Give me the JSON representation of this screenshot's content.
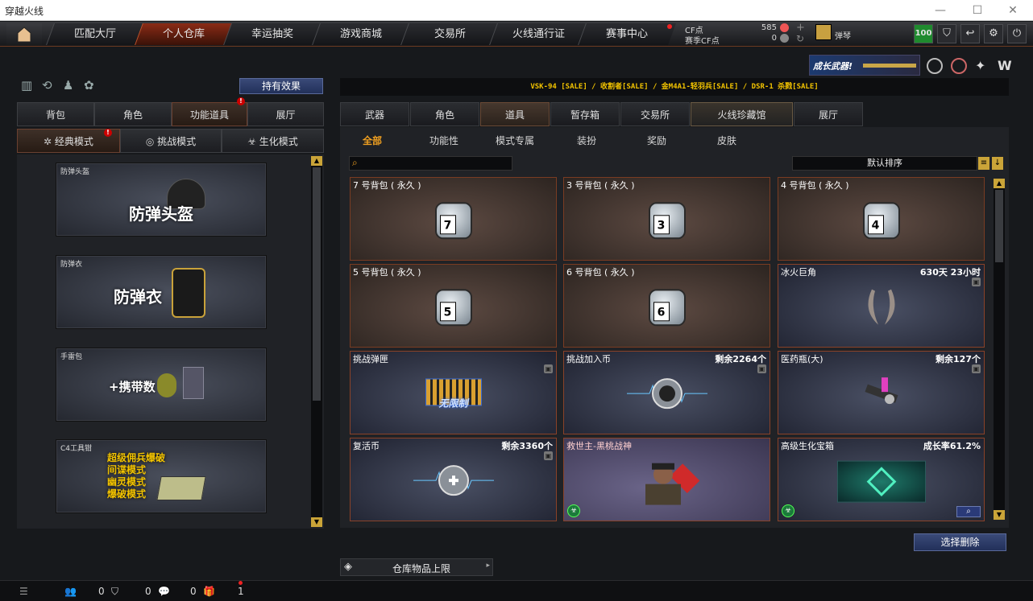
{
  "window": {
    "title": "穿越火线"
  },
  "nav": {
    "tabs": [
      {
        "label": "匹配大厅"
      },
      {
        "label": "个人仓库"
      },
      {
        "label": "幸运抽奖"
      },
      {
        "label": "游戏商城"
      },
      {
        "label": "交易所"
      },
      {
        "label": "火线通行证"
      },
      {
        "label": "赛事中心"
      }
    ],
    "cf_label": "CF点",
    "cf_value": "585",
    "event_cf_label": "赛季CF点",
    "event_cf_value": "0",
    "player_name": "弹琴",
    "level_badge": "100"
  },
  "banner": {
    "text": "成长武器!"
  },
  "left": {
    "effect_button": "持有效果",
    "tabs": [
      {
        "label": "背包"
      },
      {
        "label": "角色"
      },
      {
        "label": "功能道具"
      },
      {
        "label": "展厅"
      }
    ],
    "modes": [
      {
        "label": "经典模式"
      },
      {
        "label": "挑战模式"
      },
      {
        "label": "生化模式"
      }
    ],
    "cards": [
      {
        "label": "防弹头盔",
        "big": "防弹头盔"
      },
      {
        "label": "防弹衣",
        "big": "防弹衣"
      },
      {
        "label": "手雷包",
        "big": "+携带数"
      },
      {
        "label": "C4工具钳",
        "big": "超级佣兵爆破\n间谍模式\n幽灵模式\n爆破模式"
      }
    ]
  },
  "ticker": {
    "text": "VSK-94 [SALE] / 收割者[SALE] / 金M4A1-轻羽兵[SALE] / DSR-1 杀戮[SALE]"
  },
  "right": {
    "tabs": [
      {
        "label": "武器"
      },
      {
        "label": "角色"
      },
      {
        "label": "道具"
      },
      {
        "label": "暂存箱"
      },
      {
        "label": "交易所"
      },
      {
        "label": "火线珍藏馆"
      },
      {
        "label": "展厅"
      }
    ],
    "subtabs": [
      {
        "label": "全部"
      },
      {
        "label": "功能性"
      },
      {
        "label": "模式专属"
      },
      {
        "label": "装扮"
      },
      {
        "label": "奖励"
      },
      {
        "label": "皮肤"
      }
    ],
    "search_placeholder": "",
    "sort_label": "默认排序",
    "items": [
      {
        "name": "7 号背包 ( 永久 )",
        "right": "",
        "bagnum": "7"
      },
      {
        "name": "3 号背包 ( 永久 )",
        "right": "",
        "bagnum": "3"
      },
      {
        "name": "4 号背包 ( 永久 )",
        "right": "",
        "bagnum": "4"
      },
      {
        "name": "5 号背包 ( 永久 )",
        "right": "",
        "bagnum": "5"
      },
      {
        "name": "6 号背包 ( 永久 )",
        "right": "",
        "bagnum": "6"
      },
      {
        "name": "冰火巨角",
        "right": "630天 23小时"
      },
      {
        "name": "挑战弹匣",
        "right": "",
        "sub": "无限制"
      },
      {
        "name": "挑战加入币",
        "right": "剩余2264个"
      },
      {
        "name": "医药瓶(大)",
        "right": "剩余127个"
      },
      {
        "name": "复活币",
        "right": "剩余3360个"
      },
      {
        "name": "救世主-黑桃战神",
        "right": ""
      },
      {
        "name": "高级生化宝箱",
        "right": "成长率61.2%"
      }
    ],
    "delete_button": "选择删除"
  },
  "storage": {
    "label": "仓库物品上限"
  },
  "bottom": {
    "count1": "0",
    "count2": "0",
    "count3": "0",
    "count4": "1"
  }
}
